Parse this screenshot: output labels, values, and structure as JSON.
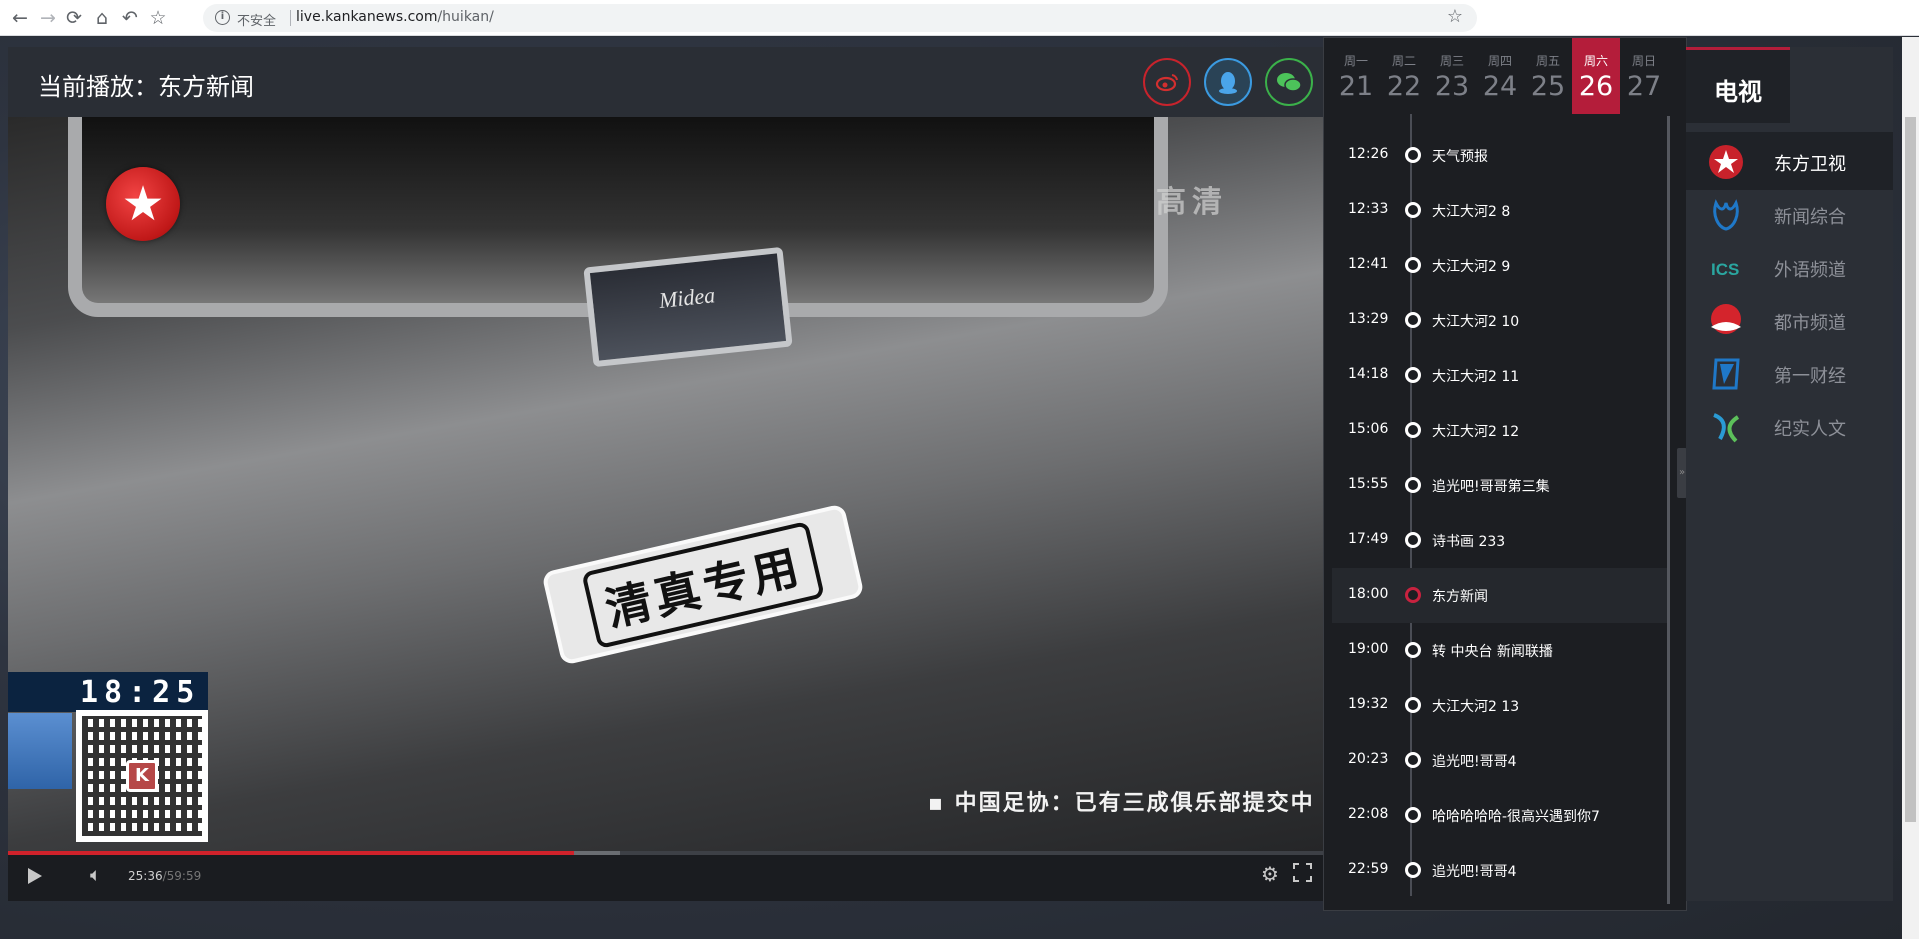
{
  "browser": {
    "insecure_label": "不安全",
    "url_host": "live.kankanews.com",
    "url_path": "/huikan/"
  },
  "player": {
    "now_playing": "当前播放：东方新闻",
    "video_hd_label": "高清",
    "video_plate_text": "Midea",
    "video_sticker_text": "清真专用",
    "video_clock": "18:25",
    "video_ticker": "▪ 中国足协：已有三成俱乐部提交中",
    "current_time": "25:36",
    "duration": "/59:59",
    "progress_played": 0.43,
    "progress_buffered": 0.465
  },
  "share": {
    "weibo_icon": "weibo-icon",
    "qq_icon": "qq-icon",
    "wechat_icon": "wechat-icon"
  },
  "schedule": {
    "days": [
      {
        "name": "周一",
        "num": "21"
      },
      {
        "name": "周二",
        "num": "22"
      },
      {
        "name": "周三",
        "num": "23"
      },
      {
        "name": "周四",
        "num": "24"
      },
      {
        "name": "周五",
        "num": "25"
      },
      {
        "name": "周六",
        "num": "26"
      },
      {
        "name": "周日",
        "num": "27"
      }
    ],
    "active_day": 5,
    "programs": [
      {
        "time": "12:26",
        "title": "天气预报"
      },
      {
        "time": "12:33",
        "title": "大江大河2 8"
      },
      {
        "time": "12:41",
        "title": "大江大河2 9"
      },
      {
        "time": "13:29",
        "title": "大江大河2 10"
      },
      {
        "time": "14:18",
        "title": "大江大河2 11"
      },
      {
        "time": "15:06",
        "title": "大江大河2 12"
      },
      {
        "time": "15:55",
        "title": "追光吧!哥哥第三集"
      },
      {
        "time": "17:49",
        "title": "诗书画 233"
      },
      {
        "time": "18:00",
        "title": "东方新闻"
      },
      {
        "time": "19:00",
        "title": "转 中央台 新闻联播"
      },
      {
        "time": "19:32",
        "title": "大江大河2 13"
      },
      {
        "time": "20:23",
        "title": "追光吧!哥哥4"
      },
      {
        "time": "22:08",
        "title": "哈哈哈哈哈-很高兴遇到你7"
      },
      {
        "time": "22:59",
        "title": "追光吧!哥哥4"
      }
    ],
    "current_index": 8
  },
  "channels": {
    "tab_label": "电视",
    "items": [
      {
        "name": "东方卫视",
        "icon": "dragon-tv-icon",
        "color": "#c8222b"
      },
      {
        "name": "新闻综合",
        "icon": "news-icon",
        "color": "#1f78c8"
      },
      {
        "name": "外语频道",
        "icon": "ics-icon",
        "color": "#2aa6a0"
      },
      {
        "name": "都市频道",
        "icon": "metro-icon",
        "color": "#d4242c"
      },
      {
        "name": "第一财经",
        "icon": "yicai-icon",
        "color": "#1f78c8"
      },
      {
        "name": "纪实人文",
        "icon": "documentary-icon",
        "color": "#3a8fd0"
      }
    ],
    "active_index": 0
  }
}
